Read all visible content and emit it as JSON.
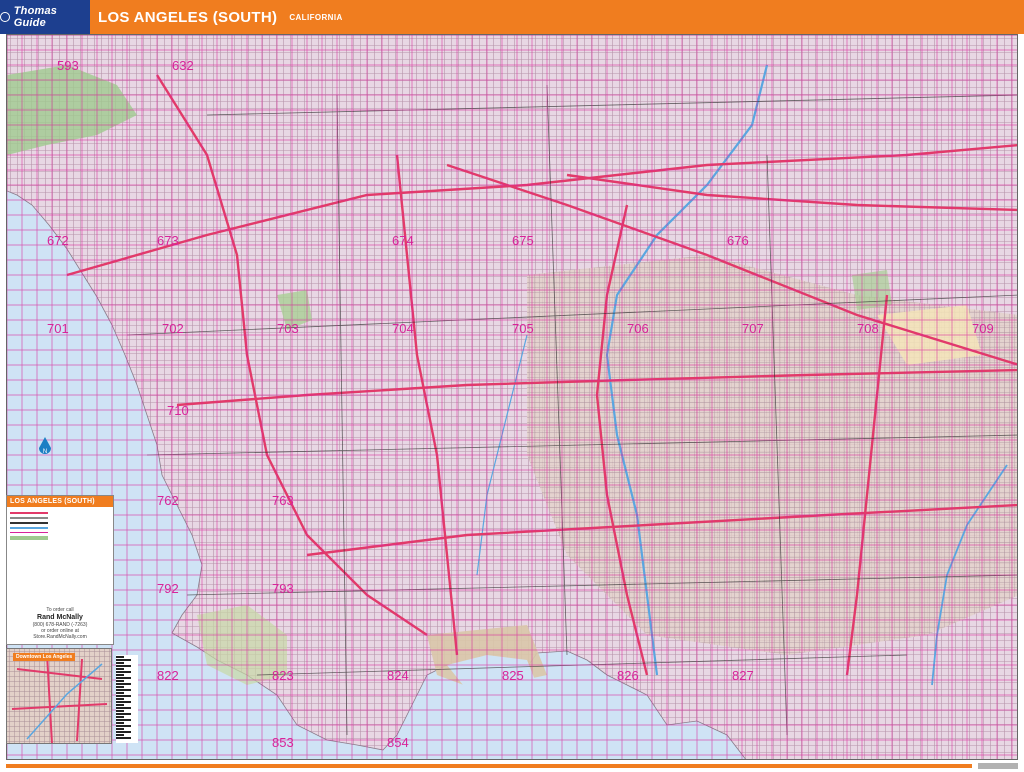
{
  "header": {
    "brand": "Thomas Guide",
    "title": "LOS ANGELES (SOUTH)",
    "state": "CALIFORNIA"
  },
  "legend": {
    "title": "LOS ANGELES (SOUTH)",
    "order_line1": "To order call",
    "order_company": "Rand McNally",
    "order_phone": "(800) 678-RAND (-7263)",
    "order_line2": "or order online at",
    "order_url": "Store.RandMcNally.com"
  },
  "inset": {
    "label": "Downtown Los Angeles"
  },
  "page_numbers": [
    "593",
    "632",
    "672",
    "673",
    "674",
    "675",
    "676",
    "701",
    "702",
    "703",
    "704",
    "705",
    "706",
    "707",
    "708",
    "709",
    "710",
    "762",
    "763",
    "792",
    "793",
    "822",
    "823",
    "824",
    "825",
    "826",
    "827",
    "853",
    "854"
  ],
  "colors": {
    "header_orange": "#f07d1f",
    "brand_blue": "#1d3f8f",
    "grid_magenta": "#d8249a",
    "ocean": "#cfe3f5",
    "land": "#e9d9e6",
    "freeway": "#e23a6a"
  }
}
